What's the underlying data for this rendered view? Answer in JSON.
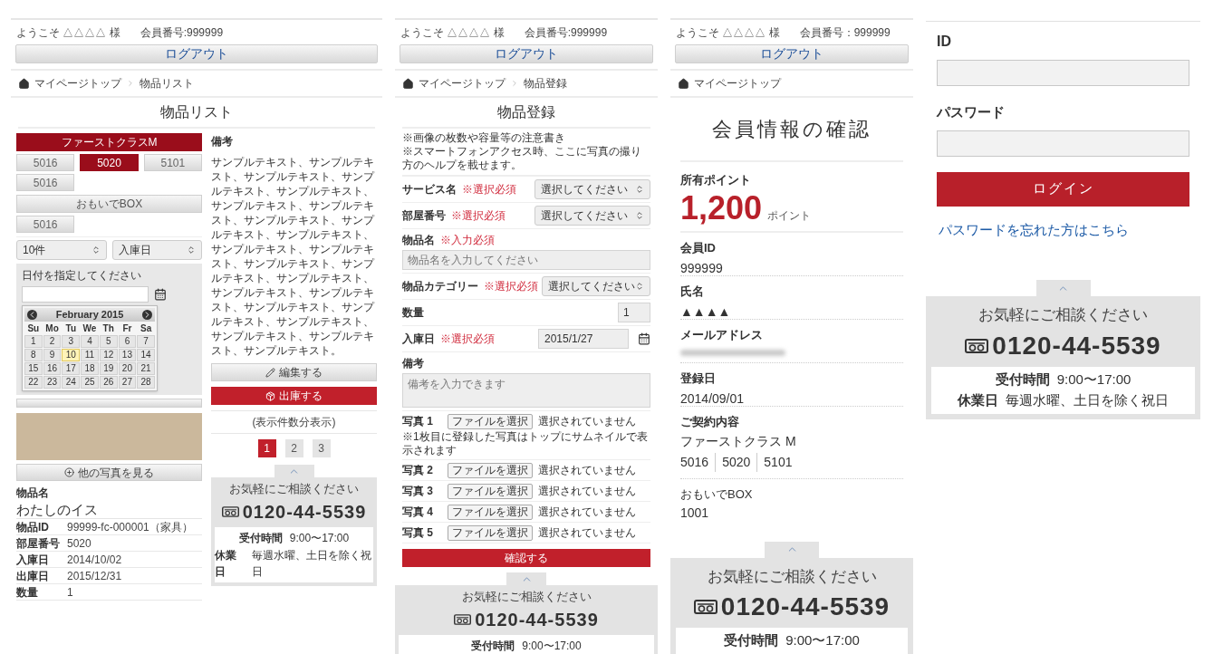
{
  "item_list": {
    "header": {
      "welcome": "ようこそ △△△△ 様",
      "member_no": "会員番号:999999",
      "logout": "ログアウト"
    },
    "breadcrumb": [
      "マイページトップ",
      "物品リスト"
    ],
    "title": "物品リスト",
    "plans": [
      {
        "name": "ファーストクラスM",
        "selected": true,
        "rooms": [
          {
            "label": "5016",
            "selected": false
          },
          {
            "label": "5020",
            "selected": true
          },
          {
            "label": "5101",
            "selected": false
          },
          {
            "label": "5016",
            "selected": false
          }
        ]
      },
      {
        "name": "おもいでBOX",
        "selected": false,
        "rooms": [
          {
            "label": "5016",
            "selected": false
          }
        ]
      }
    ],
    "selects": [
      "10件",
      "入庫日"
    ],
    "date_filter": {
      "label": "日付を指定してください"
    },
    "calendar": {
      "month": "February 2015",
      "weekdays": [
        "Su",
        "Mo",
        "Tu",
        "We",
        "Th",
        "Fr",
        "Sa"
      ],
      "weeks": [
        [
          {
            "d": "1",
            "today": false
          },
          {
            "d": "2",
            "today": false
          },
          {
            "d": "3",
            "today": false
          },
          {
            "d": "4",
            "today": false
          },
          {
            "d": "5",
            "today": false
          },
          {
            "d": "6",
            "today": false
          },
          {
            "d": "7",
            "today": false
          }
        ],
        [
          {
            "d": "8",
            "today": false
          },
          {
            "d": "9",
            "today": false
          },
          {
            "d": "10",
            "today": true
          },
          {
            "d": "11",
            "today": false
          },
          {
            "d": "12",
            "today": false
          },
          {
            "d": "13",
            "today": false
          },
          {
            "d": "14",
            "today": false
          }
        ],
        [
          {
            "d": "15",
            "today": false
          },
          {
            "d": "16",
            "today": false
          },
          {
            "d": "17",
            "today": false
          },
          {
            "d": "18",
            "today": false
          },
          {
            "d": "19",
            "today": false
          },
          {
            "d": "20",
            "today": false
          },
          {
            "d": "21",
            "today": false
          }
        ],
        [
          {
            "d": "22",
            "today": false
          },
          {
            "d": "23",
            "today": false
          },
          {
            "d": "24",
            "today": false
          },
          {
            "d": "25",
            "today": false
          },
          {
            "d": "26",
            "today": false
          },
          {
            "d": "27",
            "today": false
          },
          {
            "d": "28",
            "today": false
          }
        ]
      ]
    },
    "more_photos": "他の写真を見る",
    "name_label": "物品名",
    "name": "わたしのイス",
    "details": [
      {
        "label": "物品ID",
        "value": "99999-fc-000001（家具）"
      },
      {
        "label": "部屋番号",
        "value": "5020"
      },
      {
        "label": "入庫日",
        "value": "2014/10/02"
      },
      {
        "label": "出庫日",
        "value": "2015/12/31"
      },
      {
        "label": "数量",
        "value": "1"
      }
    ],
    "notes_label": "備考",
    "notes": "サンプルテキスト、サンプルテキスト、サンプルテキスト、サンプルテキスト、サンプルテキスト、サンプルテキスト、サンプルテキスト、サンプルテキスト、サンプルテキスト、サンプルテキスト、サンプルテキスト、サンプルテキスト、サンプルテキスト、サンプルテキスト、サンプルテキスト、サンプルテキスト、サンプルテキスト、サンプルテキスト、サンプルテキスト、サンプルテキスト、サンプルテキスト、サンプルテキスト、サンプルテキスト。",
    "edit": "編集する",
    "ship": "出庫する",
    "count_note": "(表示件数分表示)",
    "pages": [
      {
        "label": "1",
        "selected": true
      },
      {
        "label": "2",
        "selected": false
      },
      {
        "label": "3",
        "selected": false
      }
    ],
    "footer": {
      "heading": "お気軽にご相談ください",
      "phone": "0120-44-5539",
      "hours_label": "受付時間",
      "hours": "9:00〜17:00",
      "closed_label": "休業日",
      "closed": "毎週水曜、土日を除く祝日"
    }
  },
  "item_register": {
    "header": {
      "welcome": "ようこそ △△△△ 様",
      "member_no": "会員番号:999999",
      "logout": "ログアウト"
    },
    "breadcrumb": [
      "マイページトップ",
      "物品登録"
    ],
    "title": "物品登録",
    "notes": [
      "※画像の枚数や容量等の注意書き",
      "※スマートフォンアクセス時、ここに写真の撮り方のヘルプを載せます。"
    ],
    "fields": [
      {
        "kind": "select",
        "label": "サービス名",
        "required": "※選択必須",
        "value": "選択してください"
      },
      {
        "kind": "select",
        "label": "部屋番号",
        "required": "※選択必須",
        "value": "選択してください"
      },
      {
        "kind": "text",
        "label": "物品名",
        "required": "※入力必須",
        "placeholder": "物品名を入力してください"
      },
      {
        "kind": "select",
        "label": "物品カテゴリー",
        "required": "※選択必須",
        "value": "選択してください"
      },
      {
        "kind": "number",
        "label": "数量",
        "value": "1"
      },
      {
        "kind": "date",
        "label": "入庫日",
        "required": "※選択必須",
        "value": "2015/1/27"
      },
      {
        "kind": "textarea",
        "label": "備考",
        "placeholder": "備考を入力できます"
      }
    ],
    "photos": [
      {
        "label": "写真 1",
        "button": "ファイルを選択",
        "status": "選択されていません",
        "note": "※1枚目に登録した写真はトップにサムネイルで表示されます"
      },
      {
        "label": "写真 2",
        "button": "ファイルを選択",
        "status": "選択されていません"
      },
      {
        "label": "写真 3",
        "button": "ファイルを選択",
        "status": "選択されていません"
      },
      {
        "label": "写真 4",
        "button": "ファイルを選択",
        "status": "選択されていません"
      },
      {
        "label": "写真 5",
        "button": "ファイルを選択",
        "status": "選択されていません"
      }
    ],
    "confirm": "確認する",
    "footer": {
      "heading": "お気軽にご相談ください",
      "phone": "0120-44-5539",
      "hours_label": "受付時間",
      "hours": "9:00〜17:00"
    }
  },
  "member_info": {
    "header": {
      "welcome": "ようこそ △△△△ 様",
      "member_no": "会員番号：999999",
      "logout": "ログアウト"
    },
    "breadcrumb": [
      "マイページトップ"
    ],
    "title": "会員情報の確認",
    "points": {
      "label": "所有ポイント",
      "value": "1,200",
      "unit": "ポイント"
    },
    "rows": [
      {
        "kind": "text",
        "label": "会員ID",
        "value": "999999"
      },
      {
        "kind": "text",
        "label": "氏名",
        "value": "▲▲▲▲"
      },
      {
        "kind": "blurred",
        "label": "メールアドレス"
      },
      {
        "kind": "text",
        "label": "登録日",
        "value": "2014/09/01"
      }
    ],
    "contract": {
      "label": "ご契約内容",
      "plan": "ファーストクラス M",
      "rooms": [
        "5016",
        "5020",
        "5101"
      ]
    },
    "extra": {
      "label": "おもいでBOX",
      "value": "1001"
    },
    "footer": {
      "heading": "お気軽にご相談ください",
      "phone": "0120-44-5539",
      "hours_label": "受付時間",
      "hours": "9:00〜17:00"
    }
  },
  "login": {
    "id_label": "ID",
    "password_label": "パスワード",
    "button": "ログイン",
    "forgot": "パスワードを忘れた方はこちら",
    "footer": {
      "heading": "お気軽にご相談ください",
      "phone": "0120-44-5539",
      "hours_label": "受付時間",
      "hours": "9:00〜17:00",
      "closed_label": "休業日",
      "closed": "毎週水曜、土日を除く祝日"
    }
  }
}
